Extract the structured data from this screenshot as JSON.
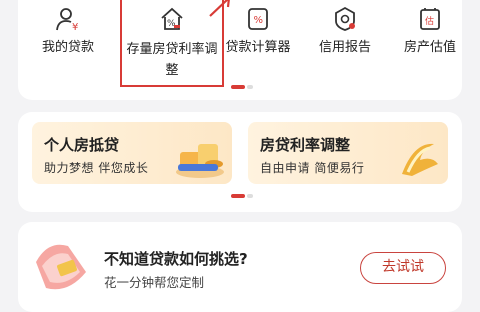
{
  "services": [
    {
      "label": "我的贷款",
      "icon": "loan-person-icon"
    },
    {
      "label": "存量房贷利率调整",
      "icon": "house-rate-icon"
    },
    {
      "label": "贷款计算器",
      "icon": "calculator-icon"
    },
    {
      "label": "信用报告",
      "icon": "credit-report-icon"
    },
    {
      "label": "房产估值",
      "icon": "property-value-icon"
    }
  ],
  "promos": [
    {
      "title": "个人房抵贷",
      "subtitle": "助力梦想 伴您成长",
      "art": "coins-illustration"
    },
    {
      "title": "房贷利率调整",
      "subtitle": "自由申请 简便易行",
      "art": "gold-spiral-illustration"
    }
  ],
  "recommend": {
    "title": "不知道贷款如何挑选?",
    "subtitle": "花一分钟帮您定制",
    "button": "去试试",
    "art": "red-packet-illustration"
  },
  "colors": {
    "accent": "#d83b36",
    "bg": "#f3f3f5",
    "tile": "#fde7c6"
  }
}
